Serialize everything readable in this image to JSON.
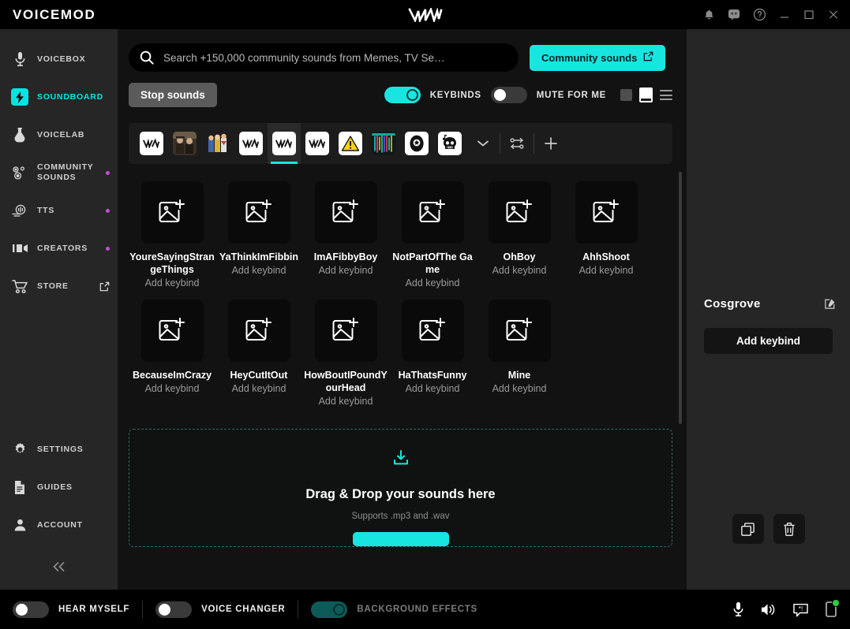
{
  "titlebar": {
    "brand": "VOICEMOD",
    "logo_icon": "voicemod-vm-logo",
    "actions": [
      {
        "name": "notifications-button",
        "icon": "bell-icon"
      },
      {
        "name": "discord-button",
        "icon": "discord-icon"
      },
      {
        "name": "help-button",
        "icon": "question-circle-icon"
      },
      {
        "name": "minimize-button",
        "icon": "minimize-icon"
      },
      {
        "name": "maximize-button",
        "icon": "maximize-icon"
      },
      {
        "name": "close-button",
        "icon": "close-icon"
      }
    ]
  },
  "sidebar": {
    "items": [
      {
        "label": "VOICEBOX",
        "icon": "microphone-icon",
        "active": false,
        "dot": false,
        "external": false
      },
      {
        "label": "SOUNDBOARD",
        "icon": "lightning-bolt-icon",
        "active": true,
        "dot": false,
        "external": false
      },
      {
        "label": "VOICELAB",
        "icon": "flask-icon",
        "active": false,
        "dot": false,
        "external": false
      },
      {
        "label": "COMMUNITY SOUNDS",
        "icon": "community-sounds-icon",
        "active": false,
        "dot": true,
        "external": false
      },
      {
        "label": "TTS",
        "icon": "text-to-speech-icon",
        "active": false,
        "dot": true,
        "external": false
      },
      {
        "label": "CREATORS",
        "icon": "video-camera-icon",
        "active": false,
        "dot": true,
        "external": false
      },
      {
        "label": "STORE",
        "icon": "shopping-cart-icon",
        "active": false,
        "dot": false,
        "external": true
      }
    ],
    "bottom_items": [
      {
        "label": "SETTINGS",
        "icon": "gear-icon"
      },
      {
        "label": "GUIDES",
        "icon": "document-icon"
      },
      {
        "label": "ACCOUNT",
        "icon": "person-icon"
      }
    ],
    "collapse_icon": "double-chevron-left-icon"
  },
  "search": {
    "placeholder": "Search +150,000 community sounds from Memes, TV Se…",
    "value": "",
    "icon": "search-icon"
  },
  "community_button": {
    "label": "Community sounds",
    "icon": "external-link-icon"
  },
  "toolbar": {
    "stop_label": "Stop sounds",
    "keybinds_label": "KEYBINDS",
    "keybinds_on": true,
    "mute_label": "MUTE FOR ME",
    "mute_on": false,
    "view_modes": [
      {
        "name": "view-mode-compact",
        "active": false
      },
      {
        "name": "view-mode-grid",
        "active": true
      },
      {
        "name": "view-mode-list",
        "active": false
      }
    ]
  },
  "tabs": {
    "items": [
      {
        "name": "tab-vm-1",
        "icon": "vm-logo-tile",
        "active": false
      },
      {
        "name": "tab-photo-men",
        "icon": "photo-two-men-tile",
        "active": false
      },
      {
        "name": "tab-cartoon",
        "icon": "cartoon-characters-tile",
        "active": false
      },
      {
        "name": "tab-vm-2",
        "icon": "vm-logo-tile",
        "active": false
      },
      {
        "name": "tab-vm-3",
        "icon": "vm-logo-tile",
        "active": true
      },
      {
        "name": "tab-vm-4",
        "icon": "vm-logo-tile",
        "active": false
      },
      {
        "name": "tab-warning",
        "icon": "warning-triangle-tile",
        "active": false
      },
      {
        "name": "tab-waveform",
        "icon": "colorful-waveform-tile",
        "active": false
      },
      {
        "name": "tab-robot",
        "icon": "robot-head-tile",
        "active": false
      },
      {
        "name": "tab-skull-music",
        "icon": "skull-music-note-tile",
        "active": false
      }
    ],
    "expand_icon": "chevron-down-icon",
    "reorder_icon": "swap-arrows-icon",
    "add_icon": "plus-icon"
  },
  "sounds": {
    "placeholder_icon": "add-image-icon",
    "keybind_label": "Add keybind",
    "items": [
      {
        "name": "YoureSayingStrangeThings"
      },
      {
        "name": "YaThinkImFibbin"
      },
      {
        "name": "ImAFibbyBoy"
      },
      {
        "name": "NotPartOfThe Game"
      },
      {
        "name": "OhBoy"
      },
      {
        "name": "AhhShoot"
      },
      {
        "name": "BecauseImCrazy"
      },
      {
        "name": "HeyCutItOut"
      },
      {
        "name": "HowBoutIPoundYourHead"
      },
      {
        "name": "HaThatsFunny"
      },
      {
        "name": "Mine"
      }
    ]
  },
  "dropzone": {
    "icon": "download-tray-icon",
    "title": "Drag & Drop your sounds here",
    "subtitle": "Supports .mp3 and .wav"
  },
  "right_panel": {
    "title": "Cosgrove",
    "edit_icon": "edit-pencil-icon",
    "add_keybind_label": "Add keybind",
    "copy_icon": "copy-icon",
    "delete_icon": "trash-icon"
  },
  "bottom_bar": {
    "hear_myself": {
      "label": "HEAR MYSELF",
      "on": false
    },
    "voice_changer": {
      "label": "VOICE CHANGER",
      "on": false
    },
    "background_effects": {
      "label": "BACKGROUND EFFECTS",
      "on": true,
      "dimmed": true
    },
    "icons": [
      {
        "name": "microphone-icon"
      },
      {
        "name": "speaker-icon"
      },
      {
        "name": "soundboard-chat-icon"
      },
      {
        "name": "mobile-device-icon",
        "status": "online"
      }
    ]
  },
  "colors": {
    "accent": "#17e6e0",
    "badge": "#c14fd6",
    "online": "#2ecc40"
  }
}
